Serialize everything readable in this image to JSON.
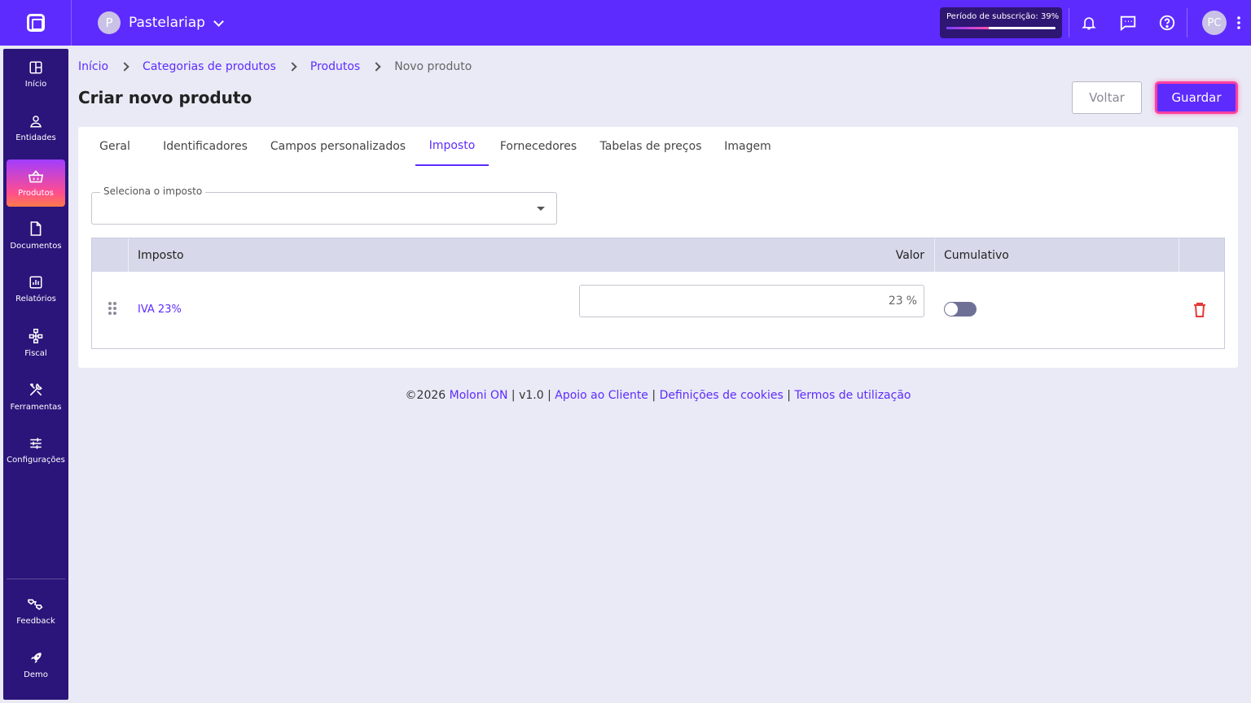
{
  "topbar": {
    "company_initial": "P",
    "company_name": "Pastelariap",
    "subscription_label": "Período de subscrição: 39%",
    "subscription_progress": 0.39,
    "user_initials": "PC"
  },
  "sidebar": {
    "items": [
      {
        "label": "Início",
        "icon": "grid-icon"
      },
      {
        "label": "Entidades",
        "icon": "user-icon"
      },
      {
        "label": "Produtos",
        "icon": "basket-icon",
        "active": true
      },
      {
        "label": "Documentos",
        "icon": "document-icon"
      },
      {
        "label": "Relatórios",
        "icon": "chart-icon"
      },
      {
        "label": "Fiscal",
        "icon": "hierarchy-icon"
      },
      {
        "label": "Ferramentas",
        "icon": "tools-icon"
      },
      {
        "label": "Configurações",
        "icon": "sliders-icon"
      }
    ],
    "bottom_items": [
      {
        "label": "Feedback",
        "icon": "feedback-icon"
      },
      {
        "label": "Demo",
        "icon": "rocket-icon"
      }
    ]
  },
  "breadcrumb": {
    "items": [
      "Início",
      "Categorias de produtos",
      "Produtos"
    ],
    "current": "Novo produto"
  },
  "page": {
    "title": "Criar novo produto",
    "back_label": "Voltar",
    "save_label": "Guardar"
  },
  "tabs": [
    "Geral",
    "Identificadores",
    "Campos personalizados",
    "Imposto",
    "Fornecedores",
    "Tabelas de preços",
    "Imagem"
  ],
  "active_tab": "Imposto",
  "tax_select": {
    "label": "Seleciona o imposto",
    "value": ""
  },
  "tax_table": {
    "columns": [
      "Imposto",
      "Valor",
      "Cumulativo"
    ],
    "rows": [
      {
        "name": "IVA 23%",
        "value": "23",
        "unit": "%",
        "cumulative": false
      }
    ]
  },
  "footer": {
    "copyright": "©2026",
    "brand": "Moloni ON",
    "version": "v1.0",
    "links": [
      "Apoio ao Cliente",
      "Definições de cookies",
      "Termos de utilização"
    ],
    "separator": "|"
  },
  "colors": {
    "primary": "#5e2bff",
    "sidebar": "#2b147a",
    "danger": "#e53935"
  }
}
